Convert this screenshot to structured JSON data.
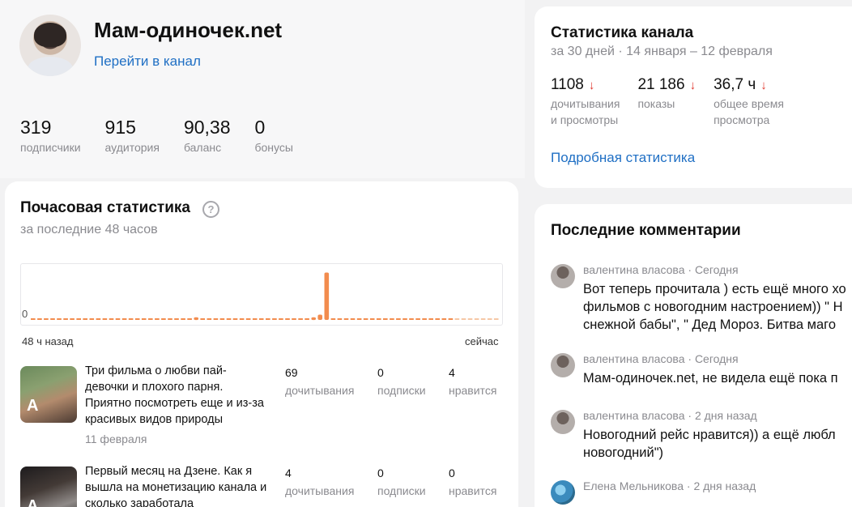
{
  "channel": {
    "name": "Мам-одиночек.net",
    "link_label": "Перейти в канал",
    "stats": [
      {
        "value": "319",
        "label": "подписчики"
      },
      {
        "value": "915",
        "label": "аудитория"
      },
      {
        "value": "90,38",
        "label": "баланс"
      },
      {
        "value": "0",
        "label": "бонусы"
      }
    ]
  },
  "hourly": {
    "title": "Почасовая статистика",
    "help_icon": "?",
    "subtitle": "за последние 48 часов",
    "zero_label": "0",
    "axis_left": "48 ч назад",
    "axis_right": "сейчас"
  },
  "chart_data": {
    "type": "bar",
    "title": "Почасовая статистика",
    "x_start_label": "48 ч назад",
    "x_end_label": "сейчас",
    "values": [
      0,
      0,
      0,
      0,
      0,
      0,
      0,
      0,
      0,
      0,
      0,
      0,
      0,
      0,
      0,
      0,
      0,
      0,
      0,
      0,
      0,
      0,
      0,
      0,
      0,
      1,
      0,
      0,
      0,
      0,
      0,
      0,
      0,
      0,
      0,
      0,
      0,
      0,
      0,
      0,
      0,
      0,
      0,
      1,
      2,
      18,
      0,
      0,
      0,
      0,
      0,
      0,
      0,
      0,
      0,
      0,
      0,
      0,
      0,
      0,
      0,
      0,
      0,
      0,
      0,
      0,
      0,
      0,
      0,
      0,
      0,
      0
    ],
    "ylim": [
      0,
      20
    ],
    "colors": {
      "bar": "#f28c4e",
      "bar_light": "#f6c7a6"
    }
  },
  "posts": [
    {
      "title": "Три фильма о любви пай-девочки и плохого парня. Приятно посмотреть еще и из-за красивых видов природы",
      "date": "11 февраля",
      "thumb_badge": "A",
      "stats": [
        {
          "value": "69",
          "label": "дочитывания"
        },
        {
          "value": "0",
          "label": "подписки"
        },
        {
          "value": "4",
          "label": "нравится"
        }
      ]
    },
    {
      "title": "Первый месяц на Дзене. Как я вышла на монетизацию канала и сколько заработала",
      "date": "",
      "thumb_badge": "A",
      "stats": [
        {
          "value": "4",
          "label": "дочитывания"
        },
        {
          "value": "0",
          "label": "подписки"
        },
        {
          "value": "0",
          "label": "нравится"
        }
      ]
    }
  ],
  "channel_stats": {
    "title": "Статистика канала",
    "period": "за 30 дней · 14 января – 12 февраля",
    "metrics": [
      {
        "value": "1108",
        "desc1": "дочитывания",
        "desc2": "и просмотры",
        "trend": "down"
      },
      {
        "value": "21 186",
        "desc1": "показы",
        "desc2": "",
        "trend": "down"
      },
      {
        "value": "36,7 ч",
        "desc1": "общее время",
        "desc2": "просмотра",
        "trend": "down"
      }
    ],
    "arrow_glyph": "↓",
    "link_label": "Подробная статистика"
  },
  "comments": {
    "title": "Последние комментарии",
    "items": [
      {
        "author": "валентина власова",
        "time": "Сегодня",
        "lines": [
          "Вот теперь прочитала ) есть ещё много хо",
          "фильмов с новогодним настроением)) \" Н",
          "снежной бабы\", \" Дед Мороз. Битва маго"
        ]
      },
      {
        "author": "валентина власова",
        "time": "Сегодня",
        "lines": [
          "Мам-одиночек.net, не видела ещё пока п"
        ]
      },
      {
        "author": "валентина власова",
        "time": "2 дня назад",
        "lines": [
          "Новогодний рейс нравится)) а ещё любл",
          "новогодний\")"
        ]
      },
      {
        "author": "Елена Мельникова",
        "time": "2 дня назад",
        "lines": [
          ""
        ]
      }
    ]
  }
}
